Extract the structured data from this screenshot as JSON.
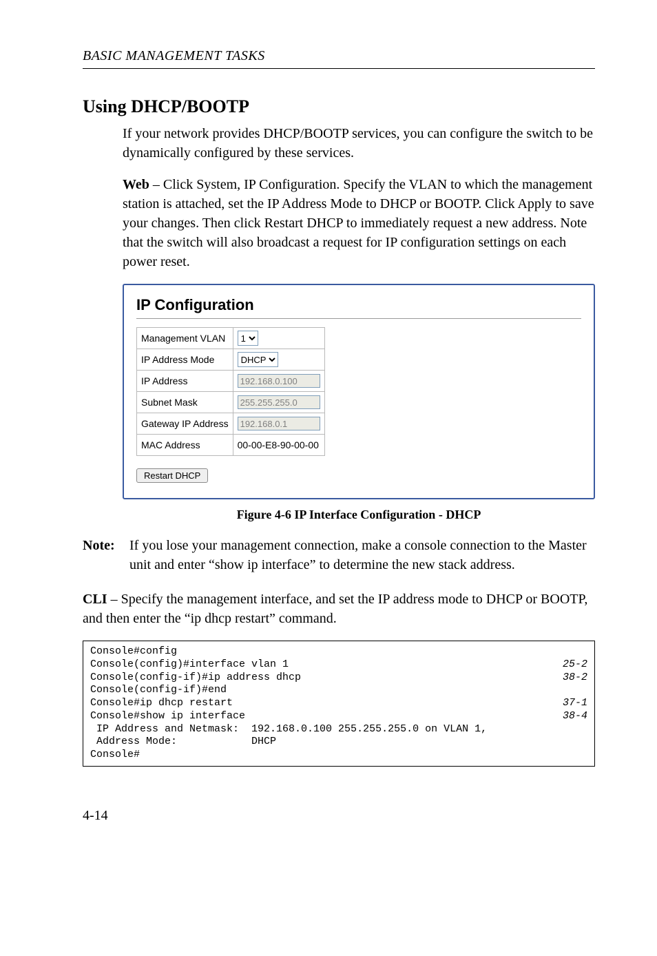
{
  "header": {
    "running": "BASIC MANAGEMENT TASKS"
  },
  "section": {
    "title": "Using DHCP/BOOTP"
  },
  "para1": "If your network provides DHCP/BOOTP services, you can configure the switch to be dynamically configured by these services.",
  "para2_lead": "Web",
  "para2": " – Click System, IP Configuration. Specify the VLAN to which the management station is attached, set the IP Address Mode to DHCP or BOOTP. Click Apply to save your changes. Then click Restart DHCP to immediately request a new address. Note that the switch will also broadcast a request for IP configuration settings on each power reset.",
  "panel": {
    "title": "IP Configuration",
    "rows": {
      "mgmt_vlan_label": "Management VLAN",
      "mgmt_vlan_value": "1",
      "mode_label": "IP Address Mode",
      "mode_value": "DHCP",
      "ip_label": "IP Address",
      "ip_value": "192.168.0.100",
      "mask_label": "Subnet Mask",
      "mask_value": "255.255.255.0",
      "gw_label": "Gateway IP Address",
      "gw_value": "192.168.0.1",
      "mac_label": "MAC Address",
      "mac_value": "00-00-E8-90-00-00"
    },
    "button": "Restart DHCP"
  },
  "figure": {
    "caption": "Figure 4-6  IP Interface Configuration - DHCP"
  },
  "note": {
    "label": "Note:",
    "text": "If you lose your management connection, make a console connection to the Master unit and enter “show ip interface” to determine the new stack address."
  },
  "cli_lead": "CLI",
  "cli_para": " – Specify the management interface, and set the IP address mode to DHCP or BOOTP, and then enter the “ip dhcp restart” command.",
  "cli": {
    "l1": "Console#config",
    "l2": "Console(config)#interface vlan 1",
    "r2": "25-2",
    "l3": "Console(config-if)#ip address dhcp",
    "r3": "38-2",
    "l4": "Console(config-if)#end",
    "l5": "Console#ip dhcp restart",
    "r5": "37-1",
    "l6": "Console#show ip interface",
    "r6": "38-4",
    "l7": " IP Address and Netmask:  192.168.0.100 255.255.255.0 on VLAN 1,",
    "l8": " Address Mode:            DHCP",
    "l9": "Console#"
  },
  "pagenum": "4-14"
}
